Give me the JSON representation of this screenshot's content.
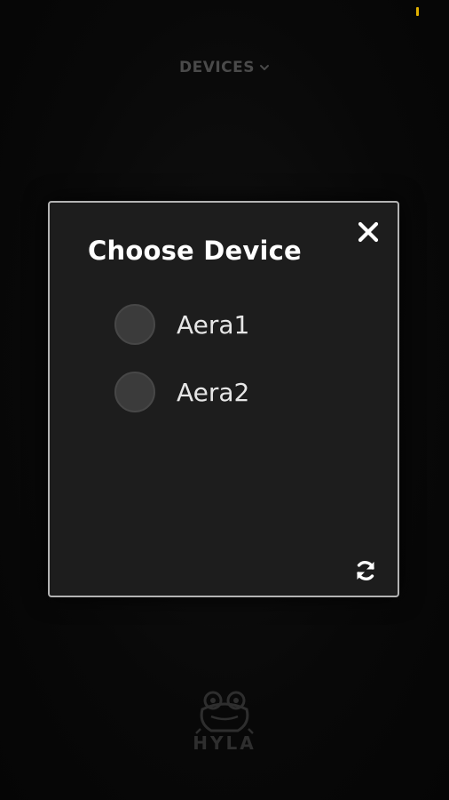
{
  "header": {
    "title": "DEVICES",
    "chevron_icon": "chevron-down-icon"
  },
  "modal": {
    "title": "Choose Device",
    "close_icon": "close-icon",
    "refresh_icon": "refresh-icon",
    "devices": [
      {
        "label": "Aera1"
      },
      {
        "label": "Aera2"
      }
    ]
  },
  "logo": {
    "text": "HYLA",
    "icon": "frog-logo-icon"
  },
  "colors": {
    "modal_background": "#1d1d1d",
    "modal_border": "#b3b3b3",
    "status_indicator": "#e0b000",
    "header_text": "#4a4a4a"
  }
}
